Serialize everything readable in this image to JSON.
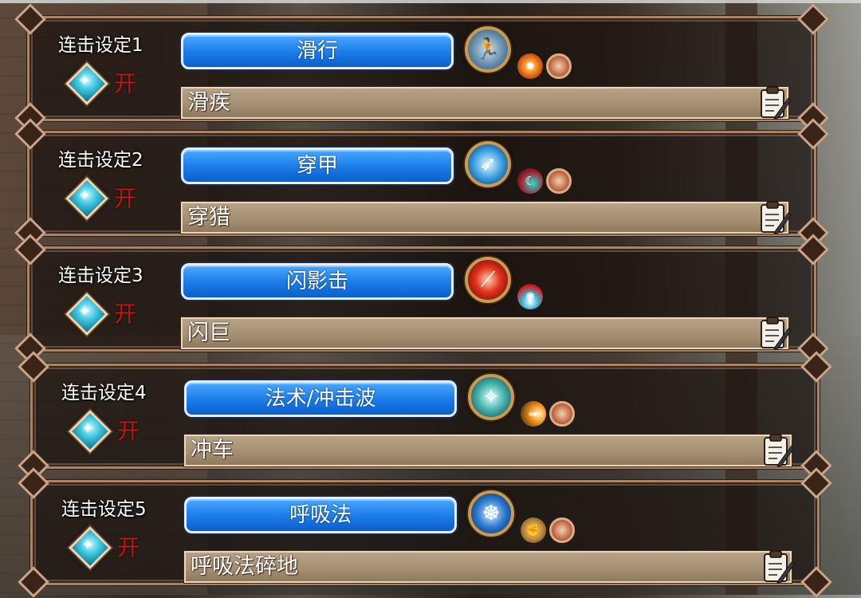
{
  "combos": [
    {
      "label": "连击设定1",
      "state": "开",
      "skill": "滑行",
      "name": "滑疾",
      "main_icon": "dash-runner-icon",
      "mini_icons": [
        "fire-burst-icon",
        "shield-emblem-icon"
      ]
    },
    {
      "label": "连击设定2",
      "state": "开",
      "skill": "穿甲",
      "name": "穿猎",
      "main_icon": "armor-pierce-icon",
      "mini_icons": [
        "crescent-slash-icon",
        "shield-emblem-icon"
      ]
    },
    {
      "label": "连击设定3",
      "state": "开",
      "skill": "闪影击",
      "name": "闪巨",
      "main_icon": "red-claw-icon",
      "mini_icons": [
        "fan-burst-icon"
      ]
    },
    {
      "label": "连击设定4",
      "state": "开",
      "skill": "法术/冲击波",
      "name": "冲车",
      "main_icon": "magic-sphere-icon",
      "mini_icons": [
        "comet-shot-icon",
        "shield-emblem-icon"
      ]
    },
    {
      "label": "连击设定5",
      "state": "开",
      "skill": "呼吸法",
      "name": "呼吸法碎地",
      "main_icon": "meditation-icon",
      "mini_icons": [
        "fist-lotus-icon",
        "shield-emblem-icon"
      ]
    }
  ],
  "colors": {
    "button_blue": "#1b7be8",
    "toggle_red": "#c41414",
    "frame_gold": "#a8856a",
    "bar_tan": "#a48d70"
  }
}
